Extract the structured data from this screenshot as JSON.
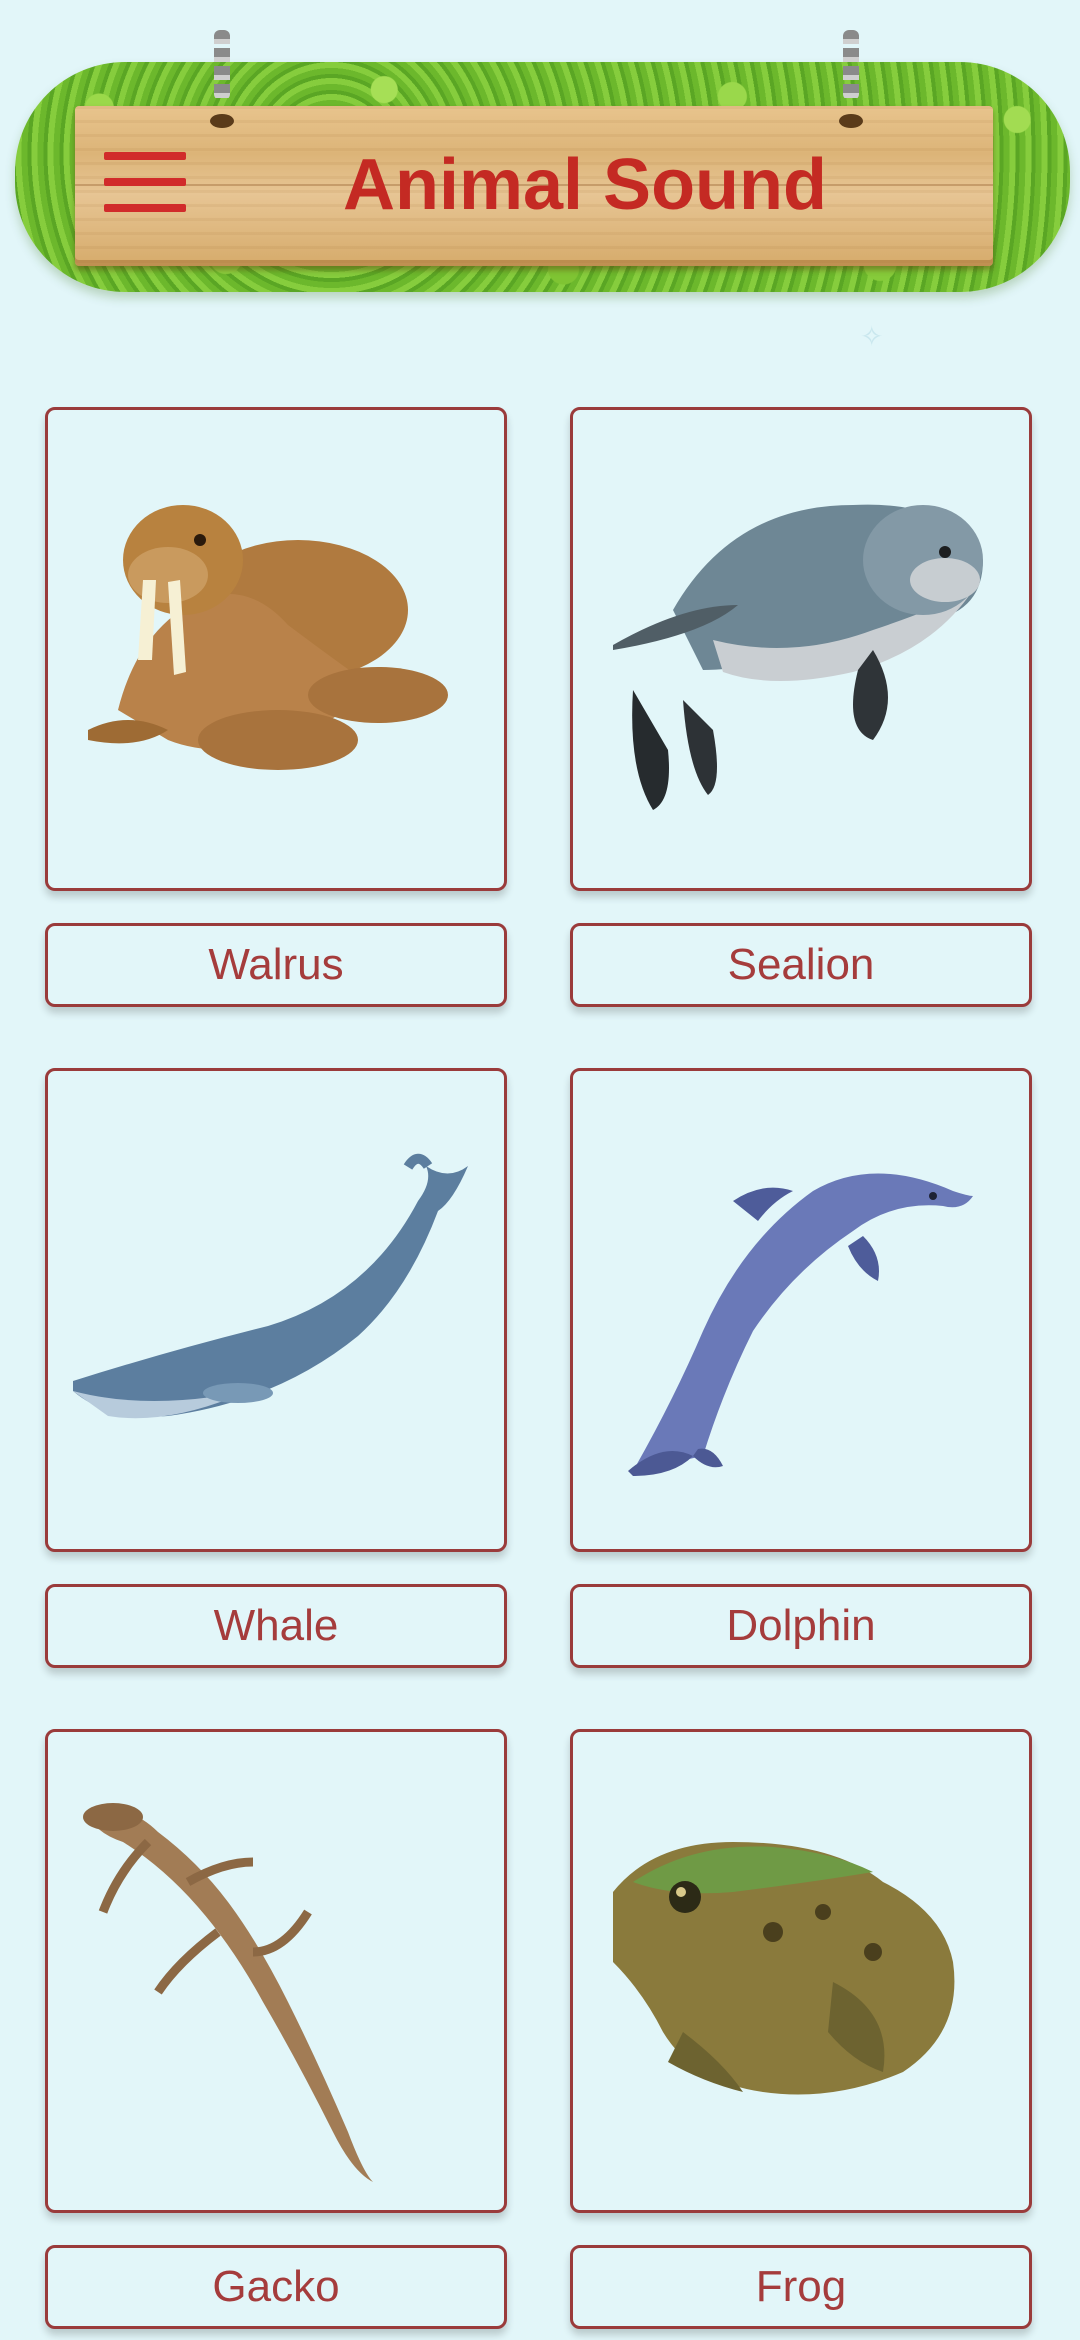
{
  "app": {
    "title": "Animal Sound"
  },
  "header": {
    "menu_icon": "hamburger-menu-icon"
  },
  "colors": {
    "background": "#e2f6f9",
    "accent": "#c42a23",
    "card_border": "#9a3b3b",
    "label_text": "#a53c3c"
  },
  "animals": [
    {
      "name": "Walrus",
      "icon": "walrus-image"
    },
    {
      "name": "Sealion",
      "icon": "sealion-image"
    },
    {
      "name": "Whale",
      "icon": "whale-image"
    },
    {
      "name": "Dolphin",
      "icon": "dolphin-image"
    },
    {
      "name": "Gacko",
      "icon": "gecko-image"
    },
    {
      "name": "Frog",
      "icon": "frog-image"
    }
  ]
}
